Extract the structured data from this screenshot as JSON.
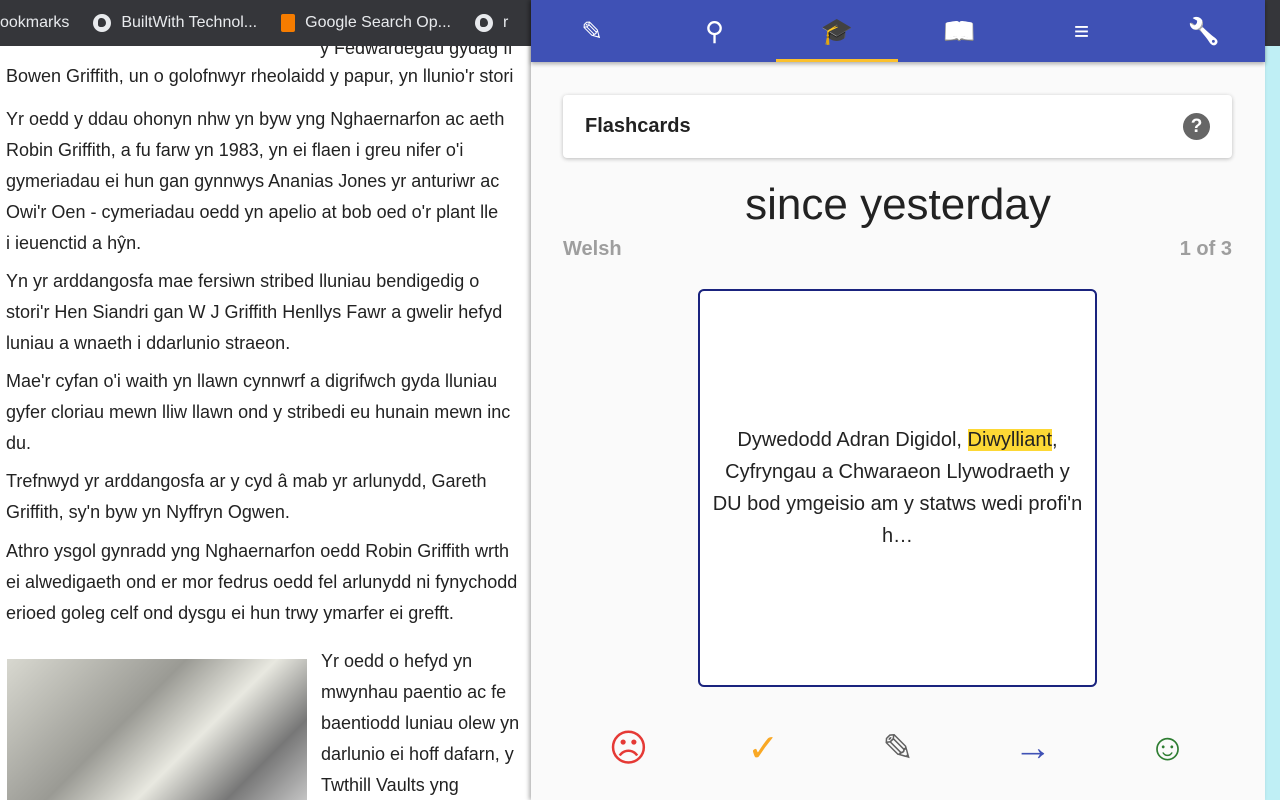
{
  "bookmarks": [
    {
      "label": "ookmarks",
      "icon": "none"
    },
    {
      "label": "BuiltWith Technol...",
      "icon": "globe-icon"
    },
    {
      "label": "Google Search Op...",
      "icon": "blogger-icon"
    },
    {
      "label": "r",
      "icon": "globe-icon"
    }
  ],
  "article": {
    "lines": [
      "y Fedwardegau gydag ff",
      "Bowen Griffith, un o golofnwyr rheolaidd y papur, yn llunio'r stori",
      "Yr oedd y ddau ohonyn nhw yn byw yng Nghaernarfon ac aeth",
      "Robin Griffith, a fu farw yn 1983, yn ei flaen i greu nifer o'i",
      "gymeriadau ei hun gan gynnwys Ananias Jones yr anturiwr ac",
      "Owi'r Oen - cymeriadau oedd yn apelio at bob oed o'r plant lle",
      "i ieuenctid a hŷn.",
      "Yn yr arddangosfa mae fersiwn stribed lluniau bendigedig o",
      "stori'r Hen Siandri gan W J Griffith Henllys Fawr a gwelir hefyd",
      "luniau a wnaeth i ddarlunio straeon.",
      "Mae'r cyfan o'i waith yn llawn cynnwrf a digrifwch gyda lluniau",
      "gyfer cloriau mewn lliw llawn ond y stribedi eu hunain mewn inc",
      "du.",
      "Trefnwyd yr arddangosfa ar y cyd â mab yr arlunydd, Gareth",
      "Griffith, sy'n byw yn Nyffryn Ogwen.",
      "Athro ysgol gynradd yng Nghaernarfon oedd Robin Griffith wrth",
      "ei alwedigaeth ond er mor fedrus oedd fel arlunydd ni fynychodd",
      "erioed goleg celf ond dysgu ei hun trwy ymarfer ei grefft.",
      "Yr oedd o hefyd yn",
      "mwynhau paentio ac fe",
      "baentiodd luniau olew yn",
      "darlunio ei hoff dafarn, y",
      "Twthill Vaults yng"
    ]
  },
  "nav": {
    "tabs": [
      {
        "icon": "pencil-icon",
        "glyph": "✎"
      },
      {
        "icon": "search-icon",
        "glyph": "⚲"
      },
      {
        "icon": "school-icon",
        "glyph": "🎓"
      },
      {
        "icon": "reader-icon",
        "glyph": "📖"
      },
      {
        "icon": "sort-icon",
        "glyph": "≡"
      },
      {
        "icon": "wrench-icon",
        "glyph": "🔧"
      }
    ],
    "active": 2
  },
  "panel": {
    "title": "Flashcards",
    "help": "?",
    "term": "since yesterday",
    "language": "Welsh",
    "counter": "1 of 3",
    "card": {
      "before": "Dywedodd Adran Digidol, ",
      "highlight": "Diwylliant",
      "after": ", Cyfryngau a Chwaraeon Llywodraeth y DU bod ymgeisio am y statws wedi profi'n h…"
    }
  },
  "actions": [
    {
      "name": "sad-face-icon",
      "glyph": "☹",
      "color": "#e53935"
    },
    {
      "name": "check-icon",
      "glyph": "✓",
      "color": "#f9a825"
    },
    {
      "name": "edit-icon",
      "glyph": "✎",
      "color": "#616161"
    },
    {
      "name": "arrow-right-icon",
      "glyph": "→",
      "color": "#3f51b5"
    },
    {
      "name": "happy-face-icon",
      "glyph": "☺",
      "color": "#2e7d32"
    }
  ],
  "colors": {
    "nav": "#3f51b5",
    "accent": "#fbc02d",
    "card_border": "#1a237e"
  }
}
